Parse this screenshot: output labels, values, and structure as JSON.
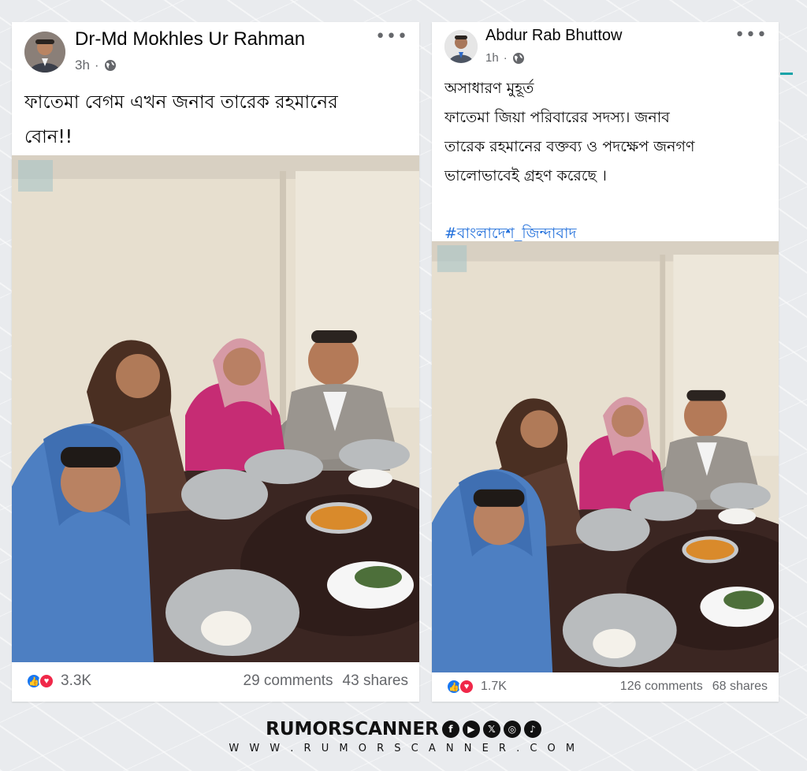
{
  "posts": [
    {
      "author": "Dr-Md Mokhles Ur Rahman",
      "time": "3h",
      "text_lines": [
        "ফাতেমা বেগম এখন জনাব তারেক রহমানের",
        "বোন!!"
      ],
      "reactions": "3.3K",
      "comments": "29 comments",
      "shares": "43 shares"
    },
    {
      "author": "Abdur Rab Bhuttow",
      "time": "1h",
      "text_lines": [
        "অসাধারণ মুহূর্ত",
        "ফাতেমা  জিয়া পরিবারের সদস্য। জনাব",
        "তারেক রহমানের বক্তব্য ও পদক্ষেপ জনগণ",
        "ভালোভাবেই গ্রহণ করেছে ।"
      ],
      "hashtag": "#বাংলাদেশ_জিন্দাবাদ",
      "reactions": "1.7K",
      "comments": "126 comments",
      "shares": "68 shares"
    }
  ],
  "separator": "·",
  "more_glyph": "•••",
  "brand": {
    "name": "RUMORSCANNER",
    "url": "W W W . R U M O R S C A N N E R . C O M",
    "social_icons": [
      "facebook-icon",
      "youtube-icon",
      "x-icon",
      "instagram-icon",
      "tiktok-icon"
    ]
  },
  "colors": {
    "link": "#216fdb",
    "like": "#1877f2",
    "love": "#f02849",
    "accent": "#19a3a8"
  }
}
